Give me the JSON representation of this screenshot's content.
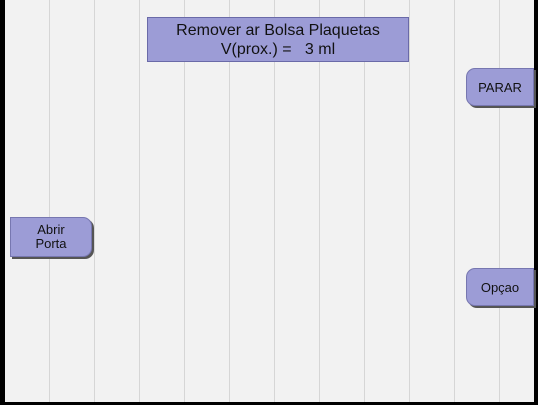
{
  "status": {
    "line1": "Remover ar Bolsa Plaquetas",
    "line2": "V(prox.) =   3 ml"
  },
  "buttons": {
    "stop_label": "PARAR",
    "open_door_line1": "Abrir",
    "open_door_line2": "Porta",
    "option_label": "Opçao"
  },
  "colors": {
    "button_fill": "#9c9cd6",
    "screen_background": "#f2f2f2"
  }
}
